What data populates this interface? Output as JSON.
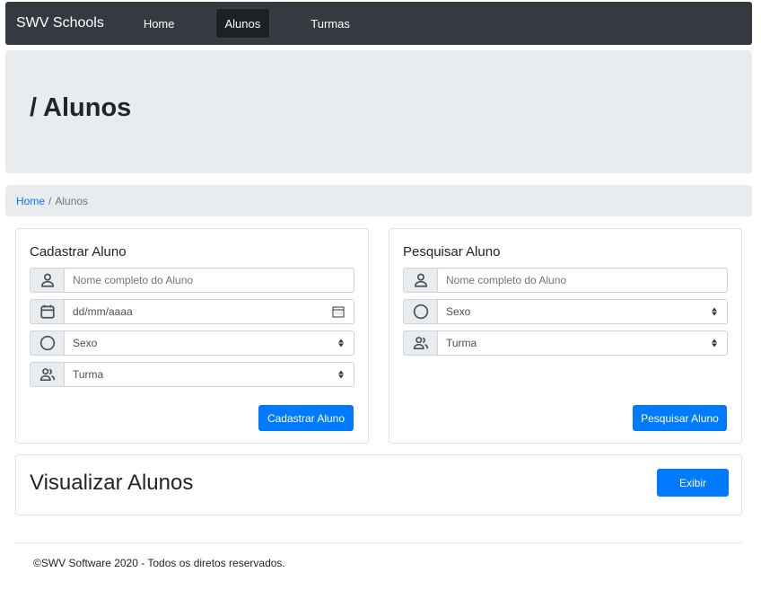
{
  "navbar": {
    "brand": "SWV Schools",
    "links": [
      {
        "label": "Home",
        "active": false
      },
      {
        "label": "Alunos",
        "active": true
      },
      {
        "label": "Turmas",
        "active": false
      }
    ]
  },
  "jumbotron": {
    "title": "/ Alunos"
  },
  "breadcrumb": {
    "home": "Home",
    "separator": "/",
    "current": "Alunos"
  },
  "cadastrar": {
    "title": "Cadastrar Aluno",
    "nome_placeholder": "Nome completo do Aluno",
    "data_placeholder": "dd/mm/aaaa",
    "sexo_selected": "Sexo",
    "turma_selected": "Turma",
    "button": "Cadastrar Aluno"
  },
  "pesquisar": {
    "title": "Pesquisar Aluno",
    "nome_placeholder": "Nome completo do Aluno",
    "sexo_selected": "Sexo",
    "turma_selected": "Turma",
    "button": "Pesquisar Aluno"
  },
  "visualizar": {
    "title": "Visualizar Alunos",
    "button": "Exibir"
  },
  "footer": {
    "text": "©SWV Software 2020 - Todos os diretos reservados."
  },
  "colors": {
    "primary": "#007bff",
    "navbar": "#343a40",
    "jumbotron": "#e9ecef"
  },
  "icons": [
    "person-icon",
    "calendar-icon",
    "circle-icon",
    "people-icon",
    "calendar-picker-icon",
    "select-caret-icon"
  ]
}
